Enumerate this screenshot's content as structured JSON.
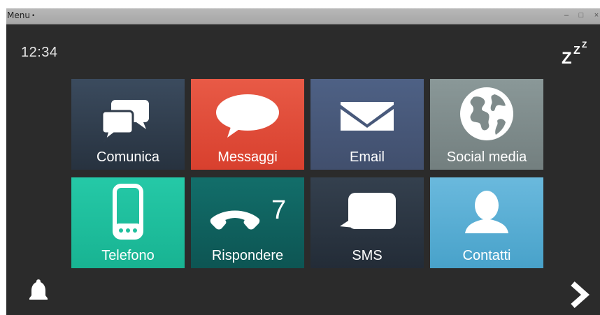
{
  "window": {
    "menu_label": "Menu",
    "menu_caret": "•",
    "controls": {
      "minimize": "–",
      "maximize": "□",
      "close": "×"
    }
  },
  "header": {
    "clock": "12:34",
    "sleep_icon": "sleep-zzz-icon"
  },
  "tiles": [
    {
      "label": "Comunica",
      "icon": "chat-bubbles-icon",
      "color": "#323f4f"
    },
    {
      "label": "Messaggi",
      "icon": "speech-bubble-icon",
      "color": "#e24c39"
    },
    {
      "label": "Email",
      "icon": "envelope-icon",
      "color": "#485979"
    },
    {
      "label": "Social media",
      "icon": "globe-icon",
      "color": "#7f8b8b"
    },
    {
      "label": "Telefono",
      "icon": "smartphone-icon",
      "color": "#1fbf9d"
    },
    {
      "label": "Rispondere",
      "icon": "phone-handset-icon",
      "color": "#10625f",
      "badge": "7"
    },
    {
      "label": "SMS",
      "icon": "sms-bubble-icon",
      "color": "#2c3642"
    },
    {
      "label": "Contatti",
      "icon": "contact-person-icon",
      "color": "#59aed4"
    }
  ],
  "footer": {
    "left_icon": "bell-icon",
    "right_icon": "chevron-right-icon"
  }
}
